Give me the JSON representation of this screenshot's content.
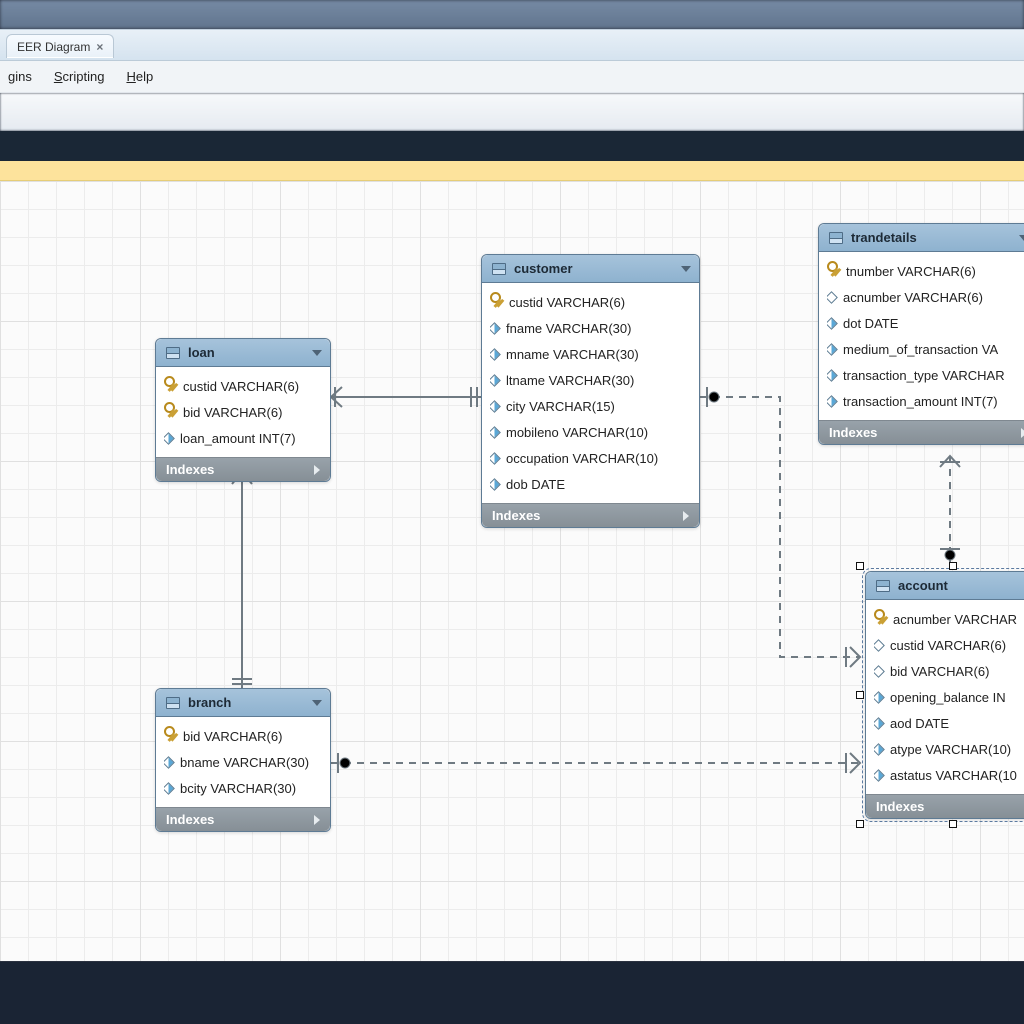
{
  "tab": {
    "label": "EER Diagram",
    "close_glyph": "×"
  },
  "menu": {
    "gins": "gins",
    "scripting": "Scripting",
    "help": "Help"
  },
  "indexes_label": "Indexes",
  "tables": {
    "loan": {
      "title": "loan",
      "columns": [
        {
          "kind": "key",
          "label": "custid VARCHAR(6)"
        },
        {
          "kind": "key",
          "label": "bid VARCHAR(6)"
        },
        {
          "kind": "col",
          "label": "loan_amount INT(7)"
        }
      ]
    },
    "customer": {
      "title": "customer",
      "columns": [
        {
          "kind": "key",
          "label": "custid VARCHAR(6)"
        },
        {
          "kind": "col",
          "label": "fname VARCHAR(30)"
        },
        {
          "kind": "col",
          "label": "mname VARCHAR(30)"
        },
        {
          "kind": "col",
          "label": "ltname VARCHAR(30)"
        },
        {
          "kind": "col",
          "label": "city VARCHAR(15)"
        },
        {
          "kind": "col",
          "label": "mobileno VARCHAR(10)"
        },
        {
          "kind": "col",
          "label": "occupation VARCHAR(10)"
        },
        {
          "kind": "col",
          "label": "dob DATE"
        }
      ]
    },
    "trandetails": {
      "title": "trandetails",
      "columns": [
        {
          "kind": "key",
          "label": "tnumber VARCHAR(6)"
        },
        {
          "kind": "fk",
          "label": "acnumber VARCHAR(6)"
        },
        {
          "kind": "col",
          "label": "dot DATE"
        },
        {
          "kind": "col",
          "label": "medium_of_transaction VA"
        },
        {
          "kind": "col",
          "label": "transaction_type VARCHAR"
        },
        {
          "kind": "col",
          "label": "transaction_amount INT(7)"
        }
      ]
    },
    "branch": {
      "title": "branch",
      "columns": [
        {
          "kind": "key",
          "label": "bid VARCHAR(6)"
        },
        {
          "kind": "col",
          "label": "bname VARCHAR(30)"
        },
        {
          "kind": "col",
          "label": "bcity VARCHAR(30)"
        }
      ]
    },
    "account": {
      "title": "account",
      "columns": [
        {
          "kind": "key",
          "label": "acnumber VARCHAR"
        },
        {
          "kind": "fk",
          "label": "custid VARCHAR(6)"
        },
        {
          "kind": "fk",
          "label": "bid VARCHAR(6)"
        },
        {
          "kind": "col",
          "label": "opening_balance IN"
        },
        {
          "kind": "col",
          "label": "aod DATE"
        },
        {
          "kind": "col",
          "label": "atype VARCHAR(10)"
        },
        {
          "kind": "col",
          "label": "astatus VARCHAR(10"
        }
      ]
    }
  }
}
